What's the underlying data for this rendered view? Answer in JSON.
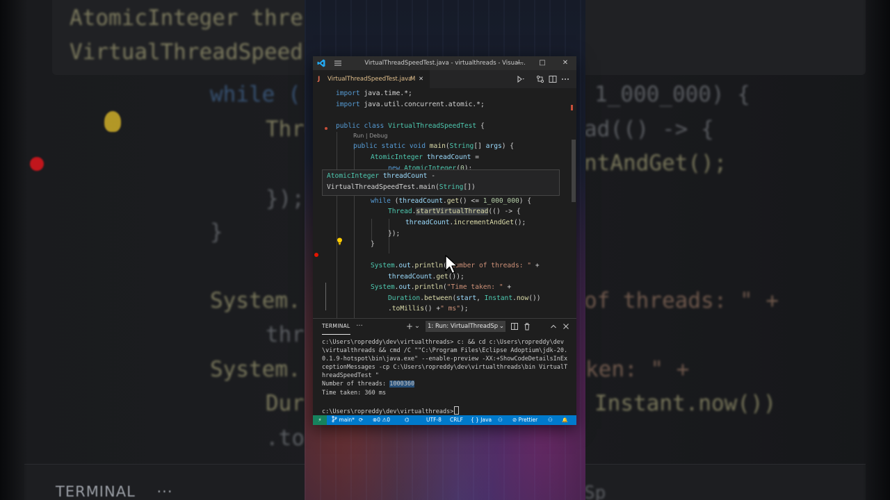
{
  "background": {
    "code_lines": [
      "AtomicInteger thre",
      "VirtualThreadSpeed",
      "while (",
      "1_000_000) {",
      "Thre",
      "ad(() -> {",
      "ntAndGet();",
      "});",
      "}",
      "System.",
      "of threads: \" +",
      "thr",
      "System.",
      "ken: \" +",
      "Dur",
      "Instant.now())",
      ".to"
    ],
    "terminal_label": "TERMINAL",
    "terminal_more": "···",
    "select_fragment": "Sp"
  },
  "window": {
    "title": "VirtualThreadSpeedTest.java - virtualthreads - Visual...",
    "controls": {
      "minimize": "—",
      "maximize": "□",
      "close": "✕"
    }
  },
  "tab": {
    "icon_letter": "J",
    "filename": "VirtualThreadSpeedTest.java",
    "modified": "M",
    "close": "✕"
  },
  "tab_actions": [
    "run-debug",
    "compare-changes",
    "split-editor",
    "more-actions"
  ],
  "code": {
    "line1": [
      "import ",
      "java.time.*",
      ";"
    ],
    "line2": [
      "import ",
      "java.util.concurrent.atomic.*",
      ";"
    ],
    "line3": [
      "public ",
      "class ",
      "VirtualThreadSpeedTest",
      " {"
    ],
    "codelens": "Run | Debug",
    "line4": [
      "public ",
      "static ",
      "void ",
      "main",
      "(",
      "String",
      "[] ",
      "args",
      ") {"
    ],
    "line5": [
      "AtomicInteger",
      " ",
      "threadCount",
      " ="
    ],
    "line6": [
      "new ",
      "AtomicInteger",
      "(",
      "0",
      ");"
    ],
    "line7": [
      "while",
      " (",
      "threadCount",
      ".",
      "get",
      "() <= ",
      "1_000_000",
      ") {"
    ],
    "line8": [
      "Thread",
      ".",
      "startVirtualThread",
      "(() -> {"
    ],
    "line9": [
      "threadCount",
      ".",
      "incrementAndGet",
      "();"
    ],
    "line10": "});",
    "line11": "}",
    "line12": [
      "System",
      ".",
      "out",
      ".",
      "println",
      "(",
      "\"Number of threads: \"",
      " +"
    ],
    "line13": [
      "threadCount",
      ".",
      "get",
      "());"
    ],
    "line14": [
      "System",
      ".",
      "out",
      ".",
      "println",
      "(",
      "\"Time taken: \"",
      " +"
    ],
    "line15": [
      "Duration",
      ".",
      "between",
      "(",
      "start",
      ", ",
      "Instant",
      ".",
      "now",
      "())"
    ],
    "line16": [
      ".",
      "toMillis",
      "() +",
      "\" ms\"",
      ");"
    ]
  },
  "hover": {
    "line1": [
      "AtomicInteger",
      " ",
      "threadCount",
      " -"
    ],
    "line2": [
      "VirtualThreadSpeedTest",
      ".",
      "main",
      "(",
      "String",
      "[])"
    ]
  },
  "terminal": {
    "tab_label": "TERMINAL",
    "more": "···",
    "add": "+",
    "add_dropdown": "⌄",
    "selected_terminal": "1: Run: VirtualThreadSp",
    "dropdown": "⌄",
    "output": "c:\\Users\\ropreddy\\dev\\virtualthreads> c: && cd c:\\Users\\ropreddy\\dev\\virtualthreads && cmd /C \"\"C:\\Program Files\\Eclipse Adoptium\\jdk-20.0.1.9-hotspot\\bin\\java.exe\" --enable-preview -XX:+ShowCodeDetailsInExceptionMessages -cp C:\\Users\\ropreddy\\dev\\virtualthreads\\bin VirtualThreadSpeedTest \"",
    "result_threads_label": "Number of threads: ",
    "result_threads_value": "1000360",
    "result_time": "Time taken: 360 ms",
    "prompt": "c:\\Users\\ropreddy\\dev\\virtualthreads>"
  },
  "statusbar": {
    "remote": "⚡",
    "branch": "main*",
    "sync": "⟳",
    "errors": "0",
    "warnings": "0",
    "encoding": "UTF-8",
    "eol": "CRLF",
    "language": "{ } Java",
    "formatter": "Prettier",
    "live_share": "⚇",
    "notifications": "🔔"
  },
  "colors": {
    "editor_bg": "#1e1e1e",
    "statusbar_bg": "#007acc",
    "keyword": "#569cd6",
    "type": "#4ec9b0",
    "function": "#dcdcaa",
    "variable": "#9cdcfe",
    "string": "#ce9178",
    "number": "#b5cea8",
    "breakpoint": "#e51400"
  }
}
